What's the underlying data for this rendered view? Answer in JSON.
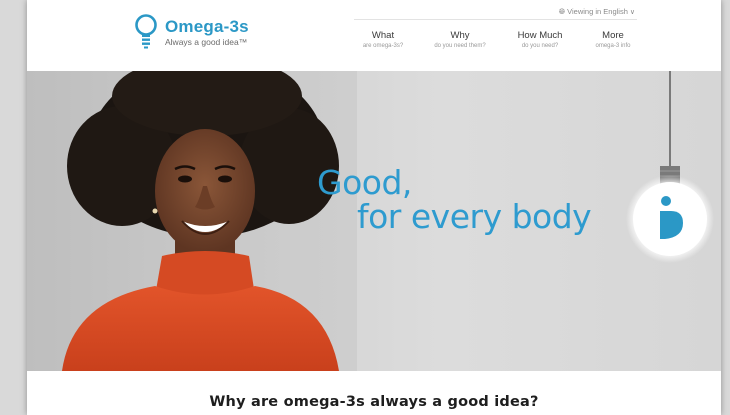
{
  "brand": {
    "name": "Omega-3s",
    "tagline": "Always a good idea™",
    "color": "#2b98c6"
  },
  "language": {
    "label": "Viewing in English",
    "icon": "globe-icon"
  },
  "nav": {
    "items": [
      {
        "label": "What",
        "sub": "are omega-3s?"
      },
      {
        "label": "Why",
        "sub": "do you need them?"
      },
      {
        "label": "How Much",
        "sub": "do you need?"
      },
      {
        "label": "More",
        "sub": "omega-3 info"
      }
    ]
  },
  "hero": {
    "headline_line1": "Good,",
    "headline_line2": "for every body",
    "accent_color": "#2e9bcf",
    "bulb_icon": "person-heart-bulb-icon"
  },
  "section": {
    "title": "Why are omega-3s always a good idea?"
  }
}
